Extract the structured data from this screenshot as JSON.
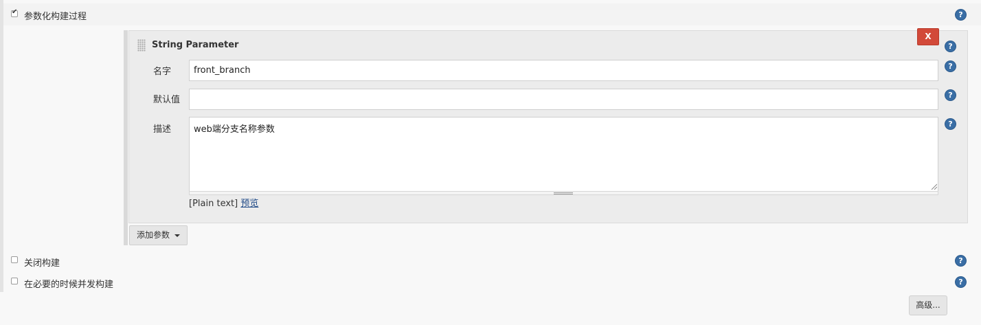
{
  "parameterized": {
    "label": "参数化构建过程",
    "checked": true
  },
  "string_param": {
    "title": "String Parameter",
    "delete_label": "X",
    "name_label": "名字",
    "name_value": "front_branch",
    "default_label": "默认值",
    "default_value": "",
    "desc_label": "描述",
    "desc_value": "web端分支名称参数",
    "format_label": "[Plain text]",
    "preview_label": "预览"
  },
  "add_param_label": "添加参数",
  "disable_build": {
    "label": "关闭构建",
    "checked": false
  },
  "concurrent_build": {
    "label": "在必要的时候并发构建",
    "checked": false
  },
  "advanced_label": "高级...",
  "colors": {
    "help_icon": "#3a6ea5",
    "delete_button": "#d24939",
    "link": "#204a87"
  }
}
